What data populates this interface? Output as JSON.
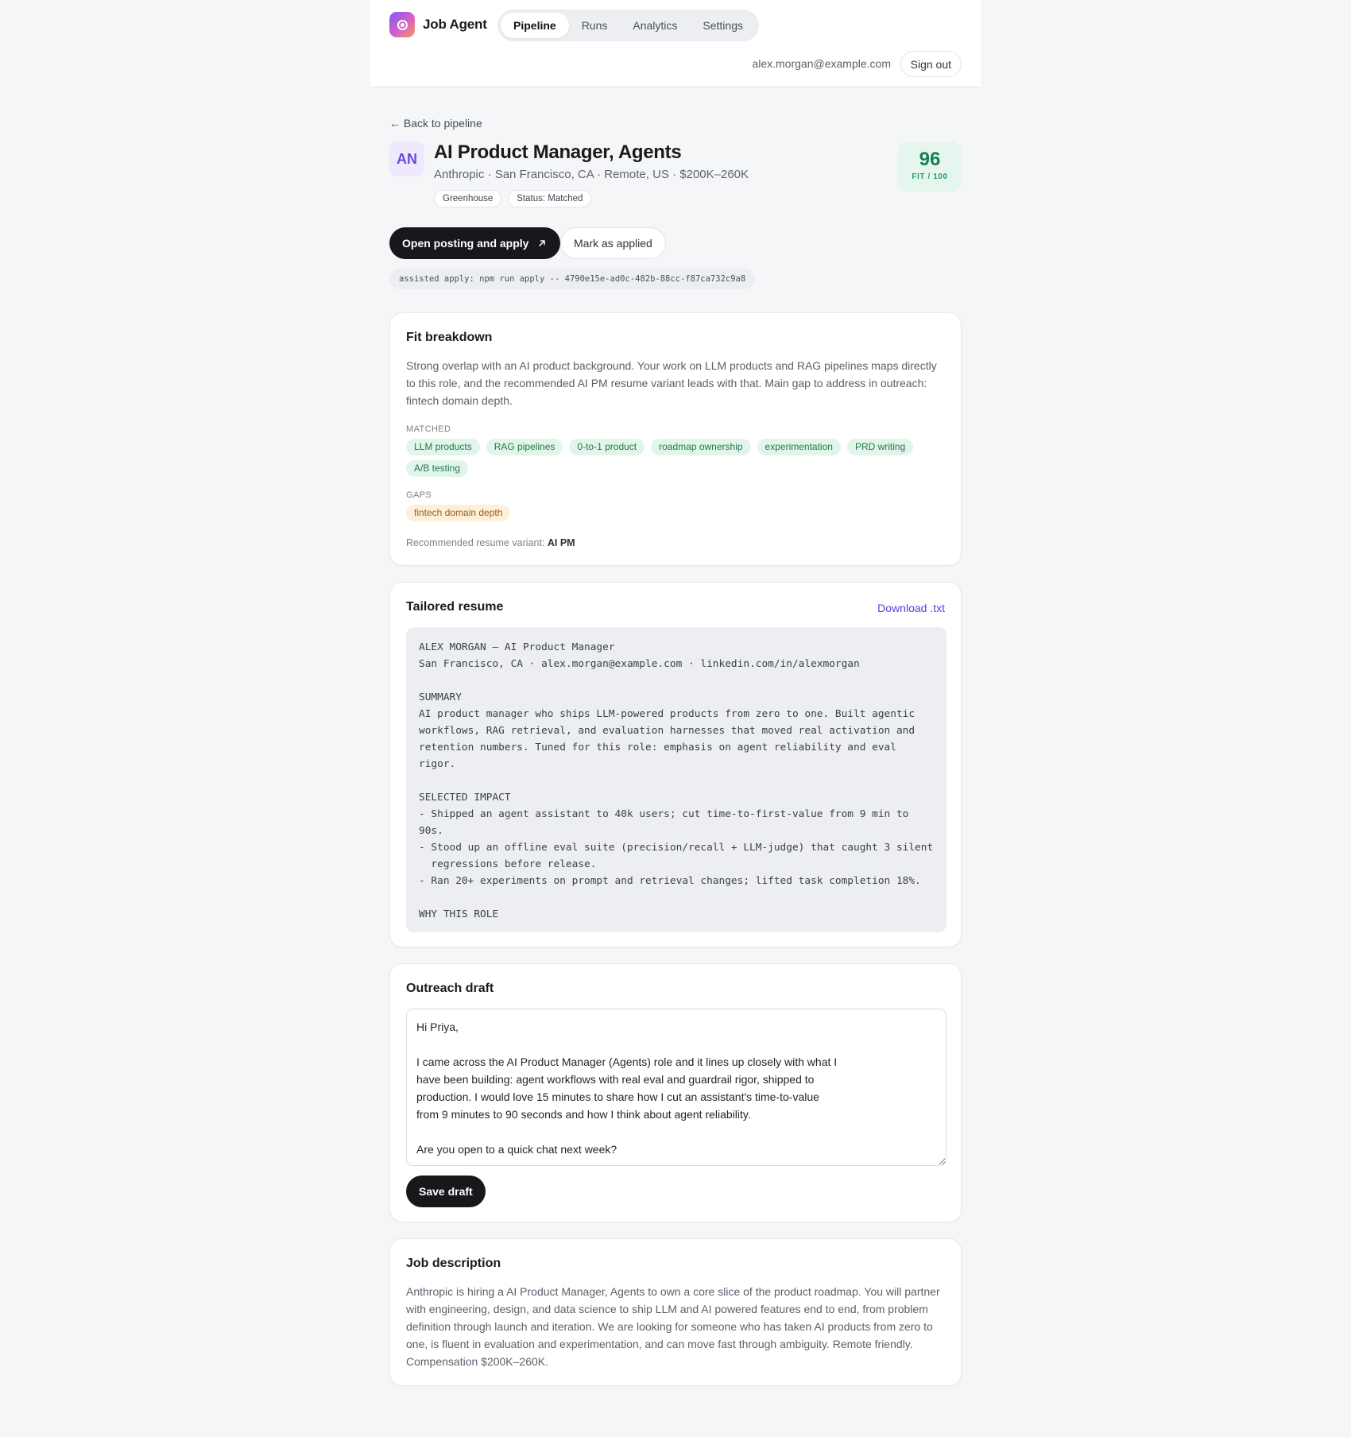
{
  "app": {
    "name": "Job Agent"
  },
  "nav": {
    "items": [
      "Pipeline",
      "Runs",
      "Analytics",
      "Settings"
    ],
    "active": "Pipeline"
  },
  "user": {
    "email": "alex.morgan@example.com",
    "signout_label": "Sign out"
  },
  "back_label": "← Back to pipeline",
  "job": {
    "initials": "AN",
    "title": "AI Product Manager, Agents",
    "meta": "Anthropic · San Francisco, CA · Remote, US · $200K–260K",
    "tags": [
      "Greenhouse",
      "Status: Matched"
    ],
    "score": "96",
    "score_label": "FIT / 100"
  },
  "actions": {
    "apply_label": "Open posting and apply",
    "mark_label": "Mark as applied",
    "command": "assisted apply: npm run apply -- 4790e15e-ad0c-482b-88cc-f87ca732c9a8"
  },
  "fit": {
    "title": "Fit breakdown",
    "summary": "Strong overlap with an AI product background. Your work on LLM products and RAG pipelines maps directly to this role, and the recommended AI PM resume variant leads with that. Main gap to address in outreach: fintech domain depth.",
    "matched_label": "MATCHED",
    "matched": [
      "LLM products",
      "RAG pipelines",
      "0-to-1 product",
      "roadmap ownership",
      "experimentation",
      "PRD writing",
      "A/B testing"
    ],
    "gaps_label": "GAPS",
    "gaps": [
      "fintech domain depth"
    ],
    "rec_label": "Recommended resume variant:",
    "rec_value": "AI PM"
  },
  "resume": {
    "title": "Tailored resume",
    "download_label": "Download .txt",
    "text": "ALEX MORGAN — AI Product Manager\nSan Francisco, CA · alex.morgan@example.com · linkedin.com/in/alexmorgan\n\nSUMMARY\nAI product manager who ships LLM-powered products from zero to one. Built agentic workflows, RAG retrieval, and evaluation harnesses that moved real activation and retention numbers. Tuned for this role: emphasis on agent reliability and eval rigor.\n\nSELECTED IMPACT\n- Shipped an agent assistant to 40k users; cut time-to-first-value from 9 min to 90s.\n- Stood up an offline eval suite (precision/recall + LLM-judge) that caught 3 silent\n  regressions before release.\n- Ran 20+ experiments on prompt and retrieval changes; lifted task completion 18%.\n\nWHY THIS ROLE"
  },
  "outreach": {
    "title": "Outreach draft",
    "draft": "Hi Priya,\n\nI came across the AI Product Manager (Agents) role and it lines up closely with what I\nhave been building: agent workflows with real eval and guardrail rigor, shipped to\nproduction. I would love 15 minutes to share how I cut an assistant's time-to-value\nfrom 9 minutes to 90 seconds and how I think about agent reliability.\n\nAre you open to a quick chat next week?",
    "save_label": "Save draft"
  },
  "description": {
    "title": "Job description",
    "text": "Anthropic is hiring a AI Product Manager, Agents to own a core slice of the product roadmap. You will partner with engineering, design, and data science to ship LLM and AI powered features end to end, from problem definition through launch and iteration. We are looking for someone who has taken AI products from zero to one, is fluent in evaluation and experimentation, and can move fast through ambiguity. Remote friendly. Compensation $200K–260K."
  }
}
